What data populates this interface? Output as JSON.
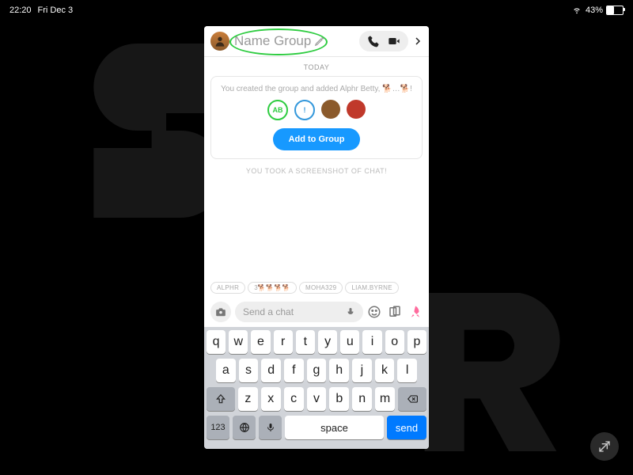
{
  "status": {
    "time": "22:20",
    "date": "Fri Dec 3",
    "wifi": true,
    "battery_pct": "43%"
  },
  "chat": {
    "group_name": "Name Group",
    "date_label": "TODAY",
    "created_text": "You created the group and added Alphr Betty, 🐕…🐕!",
    "member_initials": "AB",
    "member_exclaim": "!",
    "add_button": "Add to Group",
    "screenshot_label": "YOU TOOK A SCREENSHOT OF CHAT!",
    "mentions": [
      "ALPHR",
      "3🐕🐕🐕🐕",
      "MOHA329",
      "LIAM.BYRNE"
    ],
    "input_placeholder": "Send a chat"
  },
  "keyboard": {
    "row1": [
      "q",
      "w",
      "e",
      "r",
      "t",
      "y",
      "u",
      "i",
      "o",
      "p"
    ],
    "row2": [
      "a",
      "s",
      "d",
      "f",
      "g",
      "h",
      "j",
      "k",
      "l"
    ],
    "row3": [
      "z",
      "x",
      "c",
      "v",
      "b",
      "n",
      "m"
    ],
    "numkey": "123",
    "space": "space",
    "send": "send"
  }
}
